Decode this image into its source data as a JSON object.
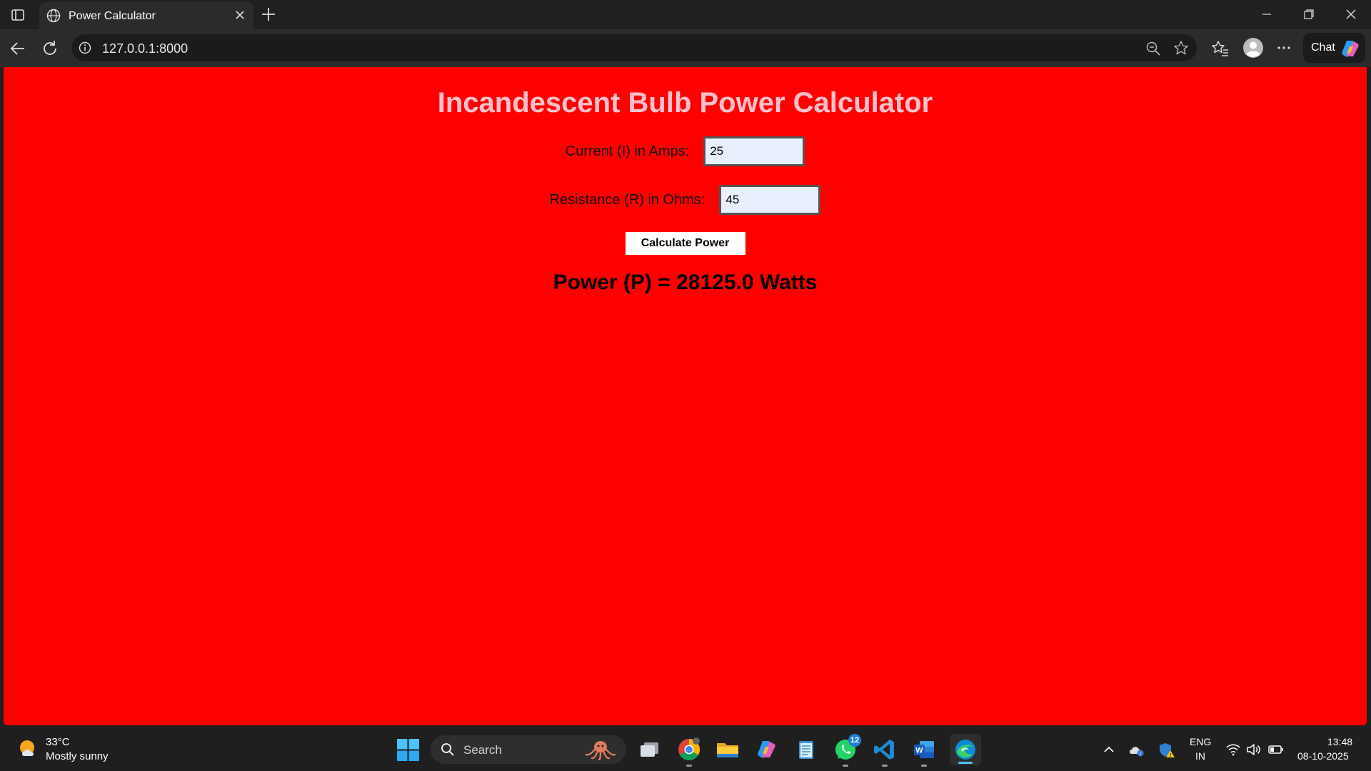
{
  "browser": {
    "tab_title": "Power Calculator",
    "url": "127.0.0.1:8000",
    "chat_label": "Chat"
  },
  "page": {
    "background": "#ff0000",
    "title_color": "#ffc0cb",
    "title": "Incandescent Bulb Power Calculator",
    "current_label": "Current (I) in Amps:",
    "current_value": "25",
    "resistance_label": "Resistance (R) in Ohms:",
    "resistance_value": "45",
    "button_label": "Calculate Power",
    "result": "Power (P) = 28125.0 Watts"
  },
  "taskbar": {
    "weather_temp": "33°C",
    "weather_desc": "Mostly sunny",
    "search_placeholder": "Search",
    "whatsapp_badge": "12",
    "lang_top": "ENG",
    "lang_bottom": "IN",
    "time": "13:48",
    "date": "08-10-2025"
  }
}
